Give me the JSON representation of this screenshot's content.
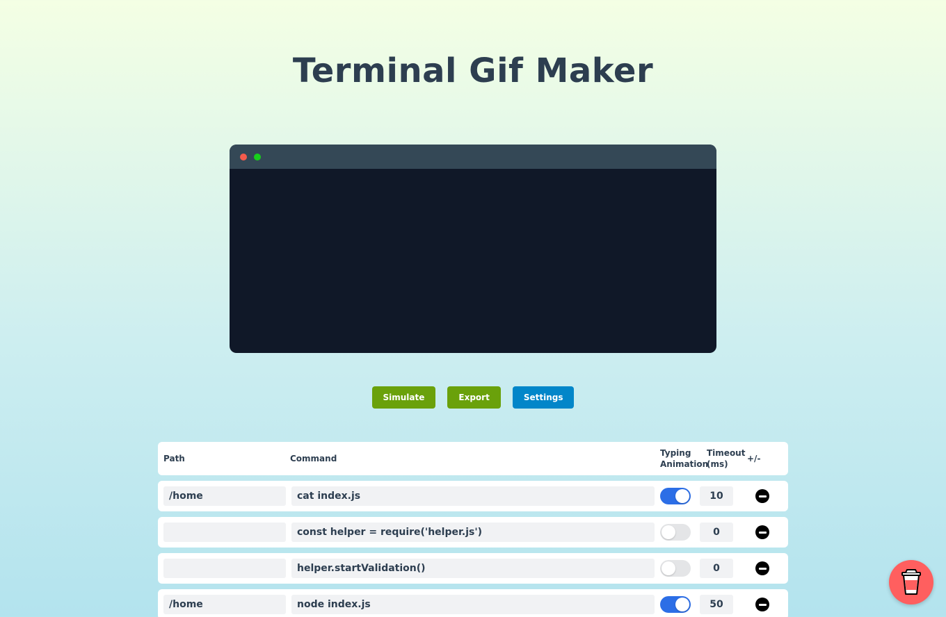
{
  "app": {
    "title": "Terminal Gif Maker"
  },
  "terminal": {
    "dot_colors": [
      "#f45b4c",
      "#17d01b"
    ]
  },
  "actions": {
    "simulate_label": "Simulate",
    "export_label": "Export",
    "settings_label": "Settings"
  },
  "table": {
    "headers": {
      "path": "Path",
      "command": "Command",
      "typing_line1": "Typing",
      "typing_line2": "Animation",
      "timeout_line1": "Timeout",
      "timeout_line2": "(ms)",
      "add_remove": "+/-"
    },
    "rows": [
      {
        "path": "/home",
        "command": "cat index.js",
        "typing": true,
        "timeout": "10"
      },
      {
        "path": "",
        "command": "const helper = require('helper.js')",
        "typing": false,
        "timeout": "0"
      },
      {
        "path": "",
        "command": "helper.startValidation()",
        "typing": false,
        "timeout": "0"
      },
      {
        "path": "/home",
        "command": "node index.js",
        "typing": true,
        "timeout": "50"
      }
    ]
  },
  "colors": {
    "primary_green": "#6aa10b",
    "primary_blue": "#0286c9",
    "toggle_on": "#2c6ee6",
    "coffee_button": "#ff5f5f"
  },
  "icons": {
    "remove": "minus-circle-icon",
    "coffee": "coffee-cup-icon"
  }
}
